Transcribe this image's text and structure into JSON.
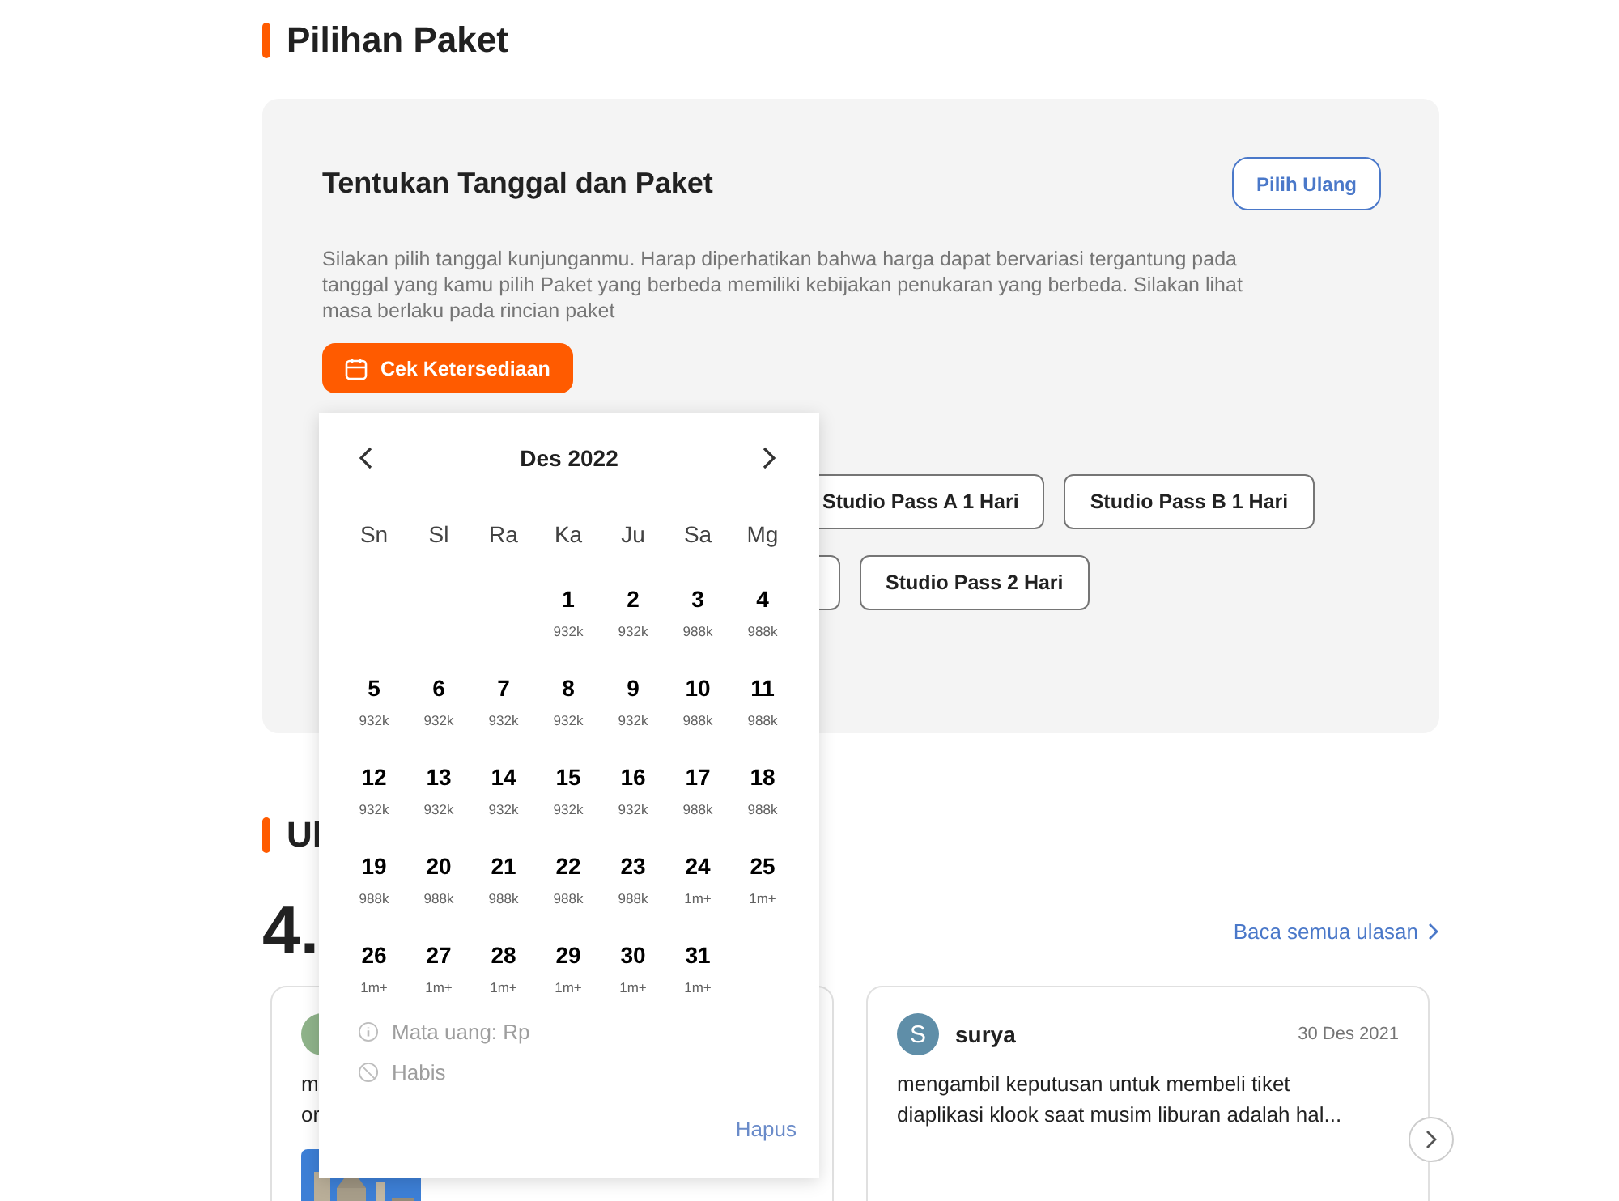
{
  "packages_section": {
    "heading": "Pilihan Paket",
    "card": {
      "title": "Tentukan Tanggal dan Paket",
      "reset_button": "Pilih Ulang",
      "description": "Silakan pilih tanggal kunjunganmu. Harap diperhatikan bahwa harga dapat bervariasi tergantung pada tanggal yang kamu pilih Paket yang berbeda memiliki kebijakan penukaran yang berbeda. Silakan lihat masa berlaku pada rincian paket",
      "availability_button": "Cek Ketersediaan",
      "package_rows": [
        [
          "Studio Pass A 1 Hari",
          "Studio Pass B 1 Hari"
        ],
        [
          "Studio Pass 2 Hari"
        ]
      ]
    }
  },
  "date_picker": {
    "month": "Des 2022",
    "weekdays": [
      "Sn",
      "Sl",
      "Ra",
      "Ka",
      "Ju",
      "Sa",
      "Mg"
    ],
    "weeks": [
      [
        {
          "day": "1",
          "price": "932k"
        },
        {
          "day": "2",
          "price": "932k"
        },
        {
          "day": "3",
          "price": "988k"
        },
        {
          "day": "4",
          "price": "988k"
        }
      ],
      [
        {
          "day": "5",
          "price": "932k"
        },
        {
          "day": "6",
          "price": "932k"
        },
        {
          "day": "7",
          "price": "932k"
        },
        {
          "day": "8",
          "price": "932k"
        },
        {
          "day": "9",
          "price": "932k"
        },
        {
          "day": "10",
          "price": "988k"
        },
        {
          "day": "11",
          "price": "988k"
        }
      ],
      [
        {
          "day": "12",
          "price": "932k"
        },
        {
          "day": "13",
          "price": "932k"
        },
        {
          "day": "14",
          "price": "932k"
        },
        {
          "day": "15",
          "price": "932k"
        },
        {
          "day": "16",
          "price": "932k"
        },
        {
          "day": "17",
          "price": "988k"
        },
        {
          "day": "18",
          "price": "988k"
        }
      ],
      [
        {
          "day": "19",
          "price": "988k"
        },
        {
          "day": "20",
          "price": "988k"
        },
        {
          "day": "21",
          "price": "988k"
        },
        {
          "day": "22",
          "price": "988k"
        },
        {
          "day": "23",
          "price": "988k"
        },
        {
          "day": "24",
          "price": "1m+"
        },
        {
          "day": "25",
          "price": "1m+"
        }
      ],
      [
        {
          "day": "26",
          "price": "1m+"
        },
        {
          "day": "27",
          "price": "1m+"
        },
        {
          "day": "28",
          "price": "1m+"
        },
        {
          "day": "29",
          "price": "1m+"
        },
        {
          "day": "30",
          "price": "1m+"
        },
        {
          "day": "31",
          "price": "1m+"
        }
      ]
    ],
    "legend": [
      {
        "kind": "info",
        "label": "Mata uang: Rp"
      },
      {
        "kind": "sold_out",
        "label": "Habis"
      }
    ],
    "clear_button": "Hapus"
  },
  "reviews_section": {
    "heading": "Ul",
    "rating": "4.",
    "read_all_link": "Baca semua ulasan",
    "reviews": [
      {
        "color": "#8fb38a",
        "text_lines": [
          "m",
          "or"
        ]
      },
      {
        "color": "#5f8ea8",
        "initial": "S",
        "name": "surya",
        "date": "30 Des 2021",
        "text_lines": [
          "mengambil keputusan untuk membeli tiket",
          "diaplikasi klook saat musim liburan adalah hal..."
        ]
      }
    ]
  }
}
